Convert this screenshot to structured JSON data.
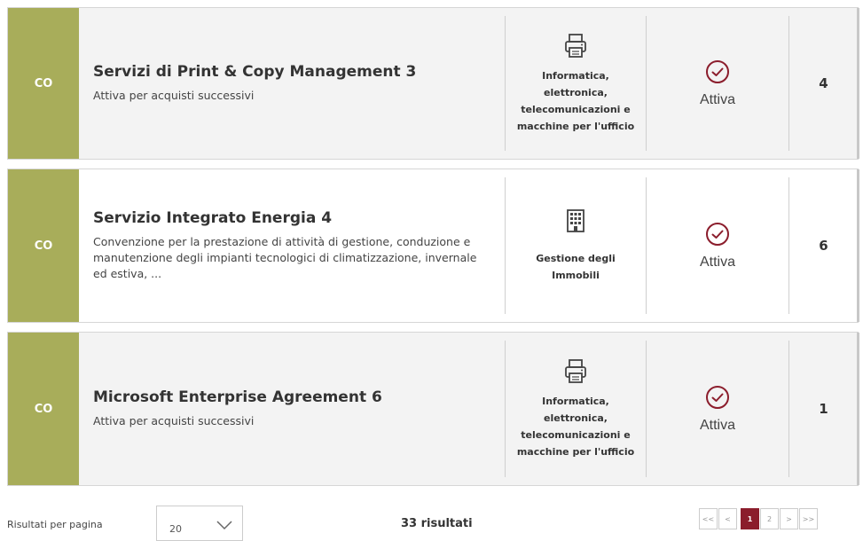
{
  "cards": [
    {
      "tag": "CO",
      "title": "Servizi di Print & Copy Management 3",
      "description": "Attiva per acquisti successivi",
      "category_icon": "printer-icon",
      "category": "Informatica, elettronica, telecomunicazioni e macchine per l'ufficio",
      "status_icon": "check-circle-icon",
      "status": "Attiva",
      "count": "4"
    },
    {
      "tag": "CO",
      "title": "Servizio Integrato Energia 4",
      "description": "Convenzione per la prestazione di attività di gestione, conduzione e manutenzione degli impianti tecnologici di climatizzazione, invernale ed estiva, ...",
      "category_icon": "building-icon",
      "category": "Gestione degli Immobili",
      "status_icon": "check-circle-icon",
      "status": "Attiva",
      "count": "6"
    },
    {
      "tag": "CO",
      "title": "Microsoft Enterprise Agreement 6",
      "description": "Attiva per acquisti successivi",
      "category_icon": "printer-icon",
      "category": "Informatica, elettronica, telecomunicazioni e macchine per l'ufficio",
      "status_icon": "check-circle-icon",
      "status": "Attiva",
      "count": "1"
    }
  ],
  "colors": {
    "tag_bg": "#a8ad5a",
    "status_icon": "#8b1d2c",
    "active_page": "#8b1d2c"
  },
  "footer": {
    "results_per_page_label": "Risultati per pagina",
    "results_per_page_value": "20",
    "total_results": "33 risultati",
    "pager": {
      "first": "<<",
      "prev": "<",
      "pages": [
        "1",
        "2"
      ],
      "current": "1",
      "next": ">",
      "last": ">>"
    }
  }
}
